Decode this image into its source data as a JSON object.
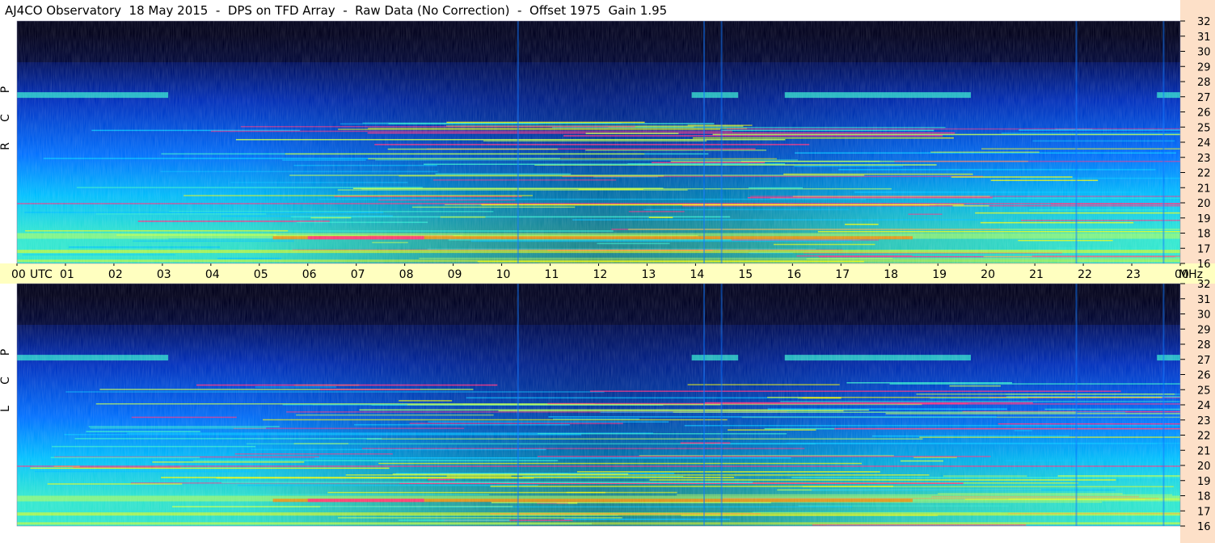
{
  "title": "AJ4CO Observatory  18 May 2015  -  DPS on TFD Array  -  Raw Data (No Correction)  -  Offset 1975  Gain 1.95",
  "colors": {
    "time_strip": "#ffffc0",
    "freq_strip": "#fde0c8",
    "background": "#ffffff",
    "colormap": [
      "#00001a",
      "#001060",
      "#0030c0",
      "#0070ff",
      "#00c0ff",
      "#30e8d0",
      "#c0ff50",
      "#ffff00",
      "#ff8000",
      "#ff3080"
    ]
  },
  "chart_data": {
    "type": "heatmap",
    "panels": [
      {
        "polarization_label": [
          "R",
          "C",
          "P"
        ],
        "x_range": [
          0,
          24
        ],
        "y_range": [
          16,
          32
        ],
        "y_ticks": [
          "16",
          "17",
          "18",
          "19",
          "20",
          "21",
          "22",
          "23",
          "24",
          "25",
          "26",
          "27",
          "28",
          "29",
          "30",
          "31",
          "32"
        ],
        "y_unit": ""
      },
      {
        "polarization_label": [
          "L",
          "C",
          "P"
        ],
        "x_range": [
          0,
          24
        ],
        "y_range": [
          16,
          32
        ],
        "y_ticks": [
          "16",
          "17",
          "18",
          "19",
          "20",
          "21",
          "22",
          "23",
          "24",
          "25",
          "26",
          "27",
          "28",
          "29",
          "30",
          "31",
          "32"
        ],
        "y_unit": "MHz"
      }
    ],
    "x_ticks": [
      "00",
      "01",
      "02",
      "03",
      "04",
      "05",
      "06",
      "07",
      "08",
      "09",
      "10",
      "11",
      "12",
      "13",
      "14",
      "15",
      "16",
      "17",
      "18",
      "19",
      "20",
      "21",
      "22",
      "23",
      "00"
    ],
    "x_unit": "UTC",
    "y_unit_label": "MHz"
  }
}
